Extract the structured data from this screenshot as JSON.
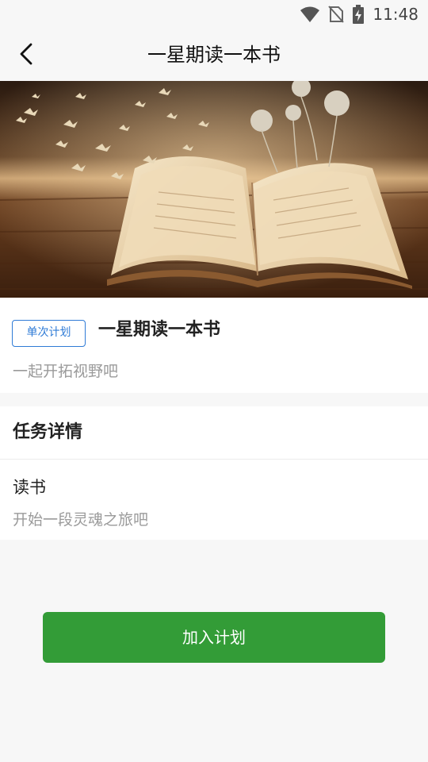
{
  "status_bar": {
    "time": "11:48",
    "icons": [
      "wifi-icon",
      "no-sim-icon",
      "battery-charging-icon"
    ]
  },
  "nav": {
    "title": "一星期读一本书",
    "back_icon": "chevron-left-icon"
  },
  "banner": {
    "image": "open-book-with-birds-photo"
  },
  "plan": {
    "tag": "单次计划",
    "title": "一星期读一本书",
    "subtitle": "一起开拓视野吧"
  },
  "details": {
    "header": "任务详情",
    "task_name": "读书",
    "task_description": "开始一段灵魂之旅吧"
  },
  "action": {
    "join_label": "加入计划",
    "color": "#339c37"
  }
}
